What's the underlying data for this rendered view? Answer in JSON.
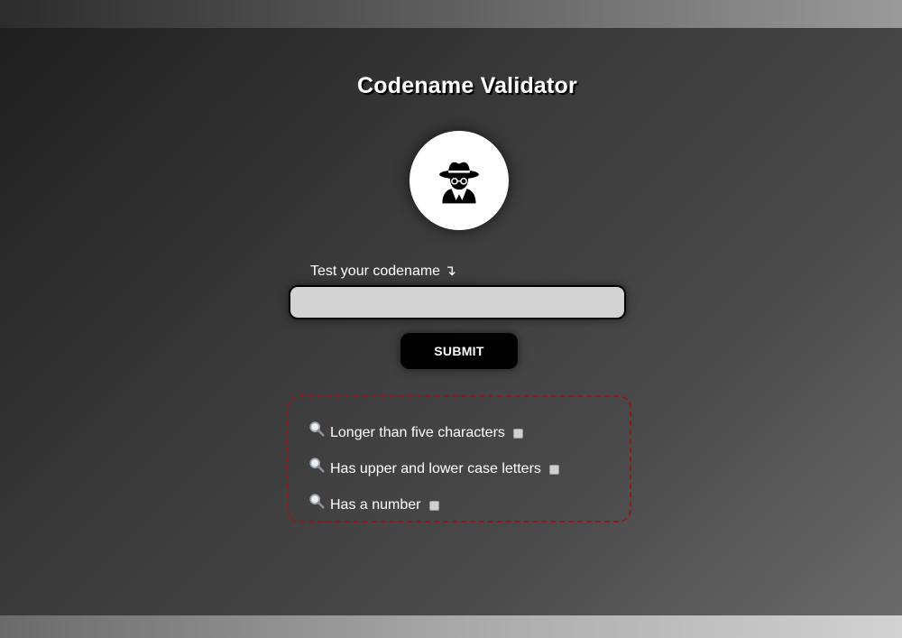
{
  "page": {
    "title": "Codename Validator",
    "avatar_icon": "spy-icon",
    "colors": {
      "text": "#ffffff",
      "input_background": "#d3d3d3",
      "button_background": "#000000",
      "checklist_border": "#8a1c1c"
    }
  },
  "form": {
    "label": "Test your codename ↴",
    "input_value": "",
    "input_placeholder": "",
    "submit_label": "SUBMIT"
  },
  "checklist": {
    "items": [
      {
        "icon": "magnifier-icon",
        "label": "Longer than five characters",
        "checked": false
      },
      {
        "icon": "magnifier-icon",
        "label": "Has upper and lower case letters",
        "checked": false
      },
      {
        "icon": "magnifier-icon",
        "label": "Has a number",
        "checked": false
      }
    ]
  }
}
